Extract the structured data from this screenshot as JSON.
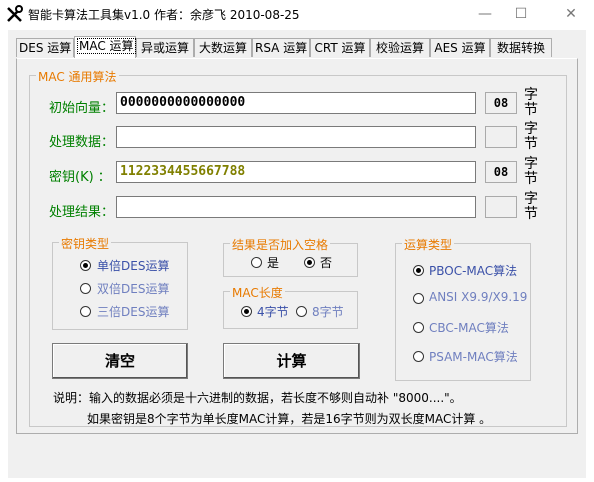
{
  "window": {
    "title": "智能卡算法工具集v1.0  作者：余彦飞 2010-08-25",
    "min_glyph": "—",
    "max_glyph": "☐",
    "close_glyph": "✕"
  },
  "tabs": [
    "DES 运算",
    "MAC 运算",
    "异或运算",
    "大数运算",
    "RSA 运算",
    "CRT 运算",
    "校验运算",
    "AES 运算",
    "数据转换"
  ],
  "active_tab": "MAC 运算",
  "mac_group": {
    "title": "MAC 通用算法"
  },
  "fields": {
    "iv": {
      "label": "初始向量：",
      "value": "0000000000000000",
      "count": "08",
      "unit": "字节"
    },
    "data": {
      "label": "处理数据：",
      "value": "",
      "count": "",
      "unit": "字节"
    },
    "key": {
      "label": "密钥(K) ：",
      "value": "1122334455667788",
      "count": "08",
      "unit": "字节"
    },
    "result": {
      "label": "处理结果：",
      "value": "",
      "count": "",
      "unit": "字节"
    }
  },
  "key_type": {
    "title": "密钥类型",
    "options": [
      "单倍DES运算",
      "双倍DES运算",
      "三倍DES运算"
    ],
    "selected": "单倍DES运算"
  },
  "space_option": {
    "title": "结果是否加入空格",
    "options": [
      "是",
      "否"
    ],
    "selected": "否"
  },
  "mac_length": {
    "title": "MAC长度",
    "options": [
      "4字节",
      "8字节"
    ],
    "selected": "4字节"
  },
  "calc_type": {
    "title": "运算类型",
    "options": [
      "PBOC-MAC算法",
      "ANSI X9.9/X9.19",
      "CBC-MAC算法",
      "PSAM-MAC算法"
    ],
    "selected": "PBOC-MAC算法"
  },
  "buttons": {
    "clear": "清空",
    "compute": "计算"
  },
  "notes": {
    "line1": "说明：输入的数据必须是十六进制的数据，若长度不够则自动补 \"8000....\"。",
    "line2": "如果密钥是8个字节为单长度MAC计算，若是16字节则为双长度MAC计算 。"
  },
  "colors": {
    "label_green": "#008000",
    "legend_orange": "#e87a00",
    "option_blue": "#6f7fbf",
    "key_text": "#808000"
  }
}
